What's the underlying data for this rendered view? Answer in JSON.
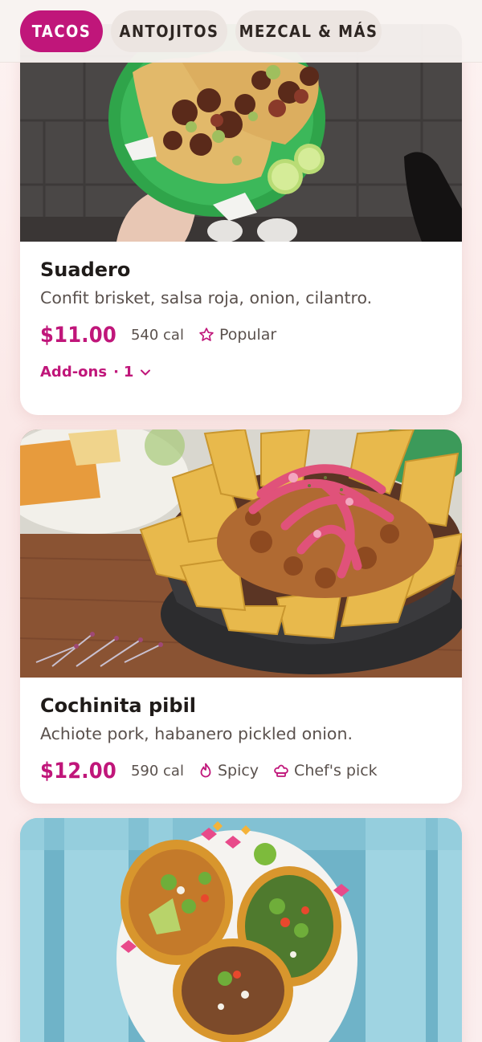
{
  "tabs": [
    {
      "label": "TACOS",
      "active": true
    },
    {
      "label": "ANTOJITOS",
      "active": false
    },
    {
      "label": "MEZCAL & MÁS",
      "active": false
    }
  ],
  "items": [
    {
      "name": "Suadero",
      "description": "Confit brisket, salsa roja, onion, cilantro.",
      "price": "$11.00",
      "calories": "540 cal",
      "tags": [
        {
          "icon": "star-icon",
          "label": "Popular"
        }
      ],
      "addons": {
        "label": "Add-ons",
        "count": "1"
      }
    },
    {
      "name": "Cochinita pibil",
      "description": "Achiote pork, habanero pickled onion.",
      "price": "$12.00",
      "calories": "590 cal",
      "tags": [
        {
          "icon": "flame-icon",
          "label": "Spicy"
        },
        {
          "icon": "chef-hat-icon",
          "label": "Chef's pick"
        }
      ]
    },
    {
      "name": "",
      "description": ""
    }
  ],
  "colors": {
    "accent": "#c0167a",
    "tab_inactive": "#ece5e1",
    "card": "#ffffff",
    "page_bg": "#fbeeee"
  }
}
